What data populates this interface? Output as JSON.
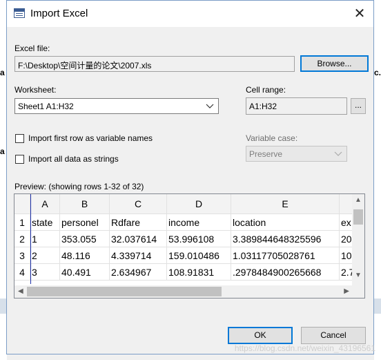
{
  "background": {
    "left_fragment": "a",
    "right_fragment": "c."
  },
  "dialog": {
    "title": "Import Excel",
    "close_label": "✕",
    "excel_file_label": "Excel file:",
    "excel_file_value": "F:\\Desktop\\空间计量的论文\\2007.xls",
    "browse_label": "Browse...",
    "worksheet_label": "Worksheet:",
    "worksheet_value": "Sheet1 A1:H32",
    "cell_range_label": "Cell range:",
    "cell_range_value": "A1:H32",
    "cell_range_button": "...",
    "first_row_label": "Import first row as variable names",
    "first_row_checked": false,
    "all_strings_label": "Import all data as strings",
    "all_strings_checked": false,
    "variable_case_label": "Variable case:",
    "variable_case_value": "Preserve",
    "preview_label": "Preview: (showing rows 1-32 of 32)",
    "ok_label": "OK",
    "cancel_label": "Cancel"
  },
  "preview": {
    "columns": [
      "A",
      "B",
      "C",
      "D",
      "E",
      ""
    ],
    "rows": [
      {
        "num": "1",
        "cells": [
          "state",
          "personel",
          "Rdfare",
          "income",
          "location",
          "ex"
        ]
      },
      {
        "num": "2",
        "cells": [
          "1",
          "353.055",
          "32.037614",
          "53.996108",
          "3.389844648325596",
          "20"
        ]
      },
      {
        "num": "3",
        "cells": [
          "2",
          "48.116",
          "4.339714",
          "159.010486",
          "1.03117705028761",
          "10"
        ]
      },
      {
        "num": "4",
        "cells": [
          "3",
          "40.491",
          "2.634967",
          "108.91831",
          ".2978484900265668",
          "2.7"
        ]
      }
    ]
  },
  "watermark": "https://blog.csdn.net/weixin_43196561",
  "colors": {
    "accent": "#0078d7",
    "row_separator": "#1c2fa8"
  }
}
